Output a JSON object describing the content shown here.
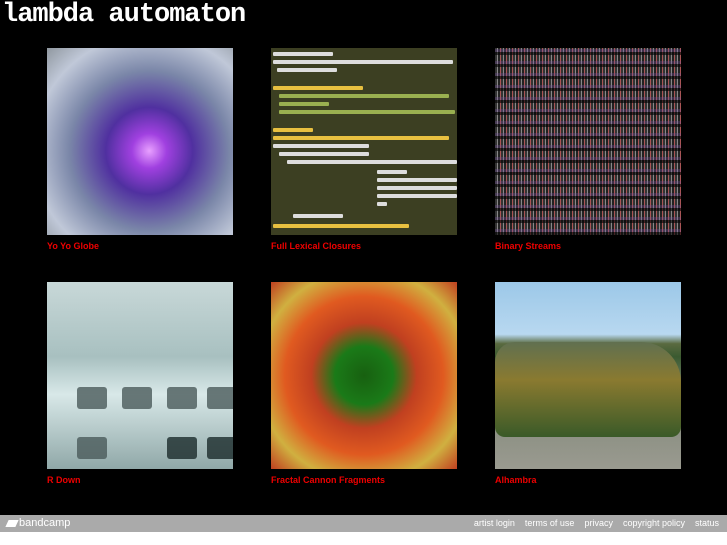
{
  "header": {
    "title": "lambda automaton"
  },
  "albums": [
    {
      "title": "Yo Yo Globe"
    },
    {
      "title": "Full Lexical Closures"
    },
    {
      "title": "Binary Streams"
    },
    {
      "title": "R Down"
    },
    {
      "title": "Fractal Cannon Fragments"
    },
    {
      "title": "Alhambra"
    }
  ],
  "footer": {
    "logo": "bandcamp",
    "links": [
      "artist login",
      "terms of use",
      "privacy",
      "copyright policy",
      "status"
    ]
  }
}
